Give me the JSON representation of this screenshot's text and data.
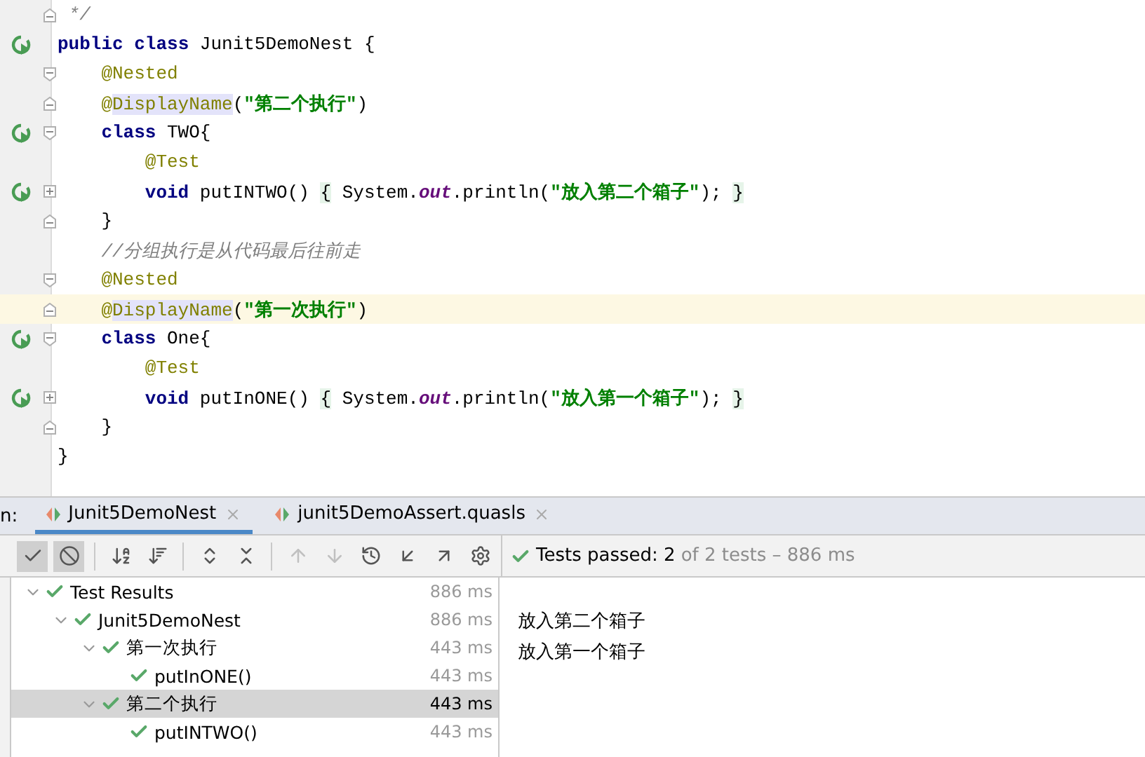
{
  "editor": {
    "lines": [
      {
        "run": false,
        "fold_open": false,
        "fold_close": true,
        "collapsed": false,
        "current": false,
        "tokens": [
          {
            "kind": "comment",
            "text": " */"
          }
        ]
      },
      {
        "run": true,
        "fold_open": false,
        "fold_close": false,
        "collapsed": false,
        "current": false,
        "tokens": [
          {
            "kind": "keyword",
            "text": "public class "
          },
          {
            "kind": "plain",
            "text": "Junit5DemoNest {"
          }
        ],
        "children": [
          {
            "run": false,
            "fold_open": true,
            "fold_close": false,
            "collapsed": false,
            "current": false,
            "tokens": [
              {
                "kind": "annotation",
                "text": "@Nested"
              }
            ]
          },
          {
            "run": false,
            "fold_open": false,
            "fold_close": true,
            "collapsed": false,
            "current": false,
            "tokens": [
              {
                "kind": "annotation",
                "text": "@"
              },
              {
                "kind": "annotation-ref",
                "text": "DisplayName"
              },
              {
                "kind": "plain",
                "text": "("
              },
              {
                "kind": "string",
                "text": "\"第二个执行\""
              },
              {
                "kind": "plain",
                "text": ")"
              }
            ]
          },
          {
            "run": true,
            "fold_open": true,
            "fold_close": false,
            "collapsed": false,
            "current": false,
            "tokens": [
              {
                "kind": "keyword",
                "text": "class "
              },
              {
                "kind": "plain",
                "text": "TWO{"
              }
            ],
            "children": [
              {
                "run": false,
                "fold_open": false,
                "fold_close": false,
                "collapsed": false,
                "current": false,
                "tokens": [
                  {
                    "kind": "annotation",
                    "text": "@Test"
                  }
                ]
              },
              {
                "run": true,
                "fold_open": false,
                "fold_close": false,
                "collapsed": true,
                "current": false,
                "tokens": [
                  {
                    "kind": "keyword",
                    "text": "void "
                  },
                  {
                    "kind": "plain",
                    "text": "putINTWO() "
                  },
                  {
                    "kind": "folded",
                    "text": "{"
                  },
                  {
                    "kind": "plain",
                    "text": " System."
                  },
                  {
                    "kind": "field",
                    "text": "out"
                  },
                  {
                    "kind": "plain",
                    "text": ".println("
                  },
                  {
                    "kind": "string",
                    "text": "\"放入第二个箱子\""
                  },
                  {
                    "kind": "plain",
                    "text": "); "
                  },
                  {
                    "kind": "folded",
                    "text": "}"
                  }
                ]
              }
            ]
          },
          {
            "run": false,
            "fold_open": false,
            "fold_close": true,
            "collapsed": false,
            "current": false,
            "tokens": [
              {
                "kind": "plain",
                "text": "}"
              }
            ]
          },
          {
            "run": false,
            "fold_open": false,
            "fold_close": false,
            "collapsed": false,
            "current": false,
            "tokens": [
              {
                "kind": "comment",
                "text": "//分组执行是从代码最后往前走"
              }
            ]
          },
          {
            "run": false,
            "fold_open": true,
            "fold_close": false,
            "collapsed": false,
            "current": false,
            "tokens": [
              {
                "kind": "annotation",
                "text": "@Nested"
              }
            ]
          },
          {
            "run": false,
            "fold_open": false,
            "fold_close": true,
            "collapsed": false,
            "current": true,
            "tokens": [
              {
                "kind": "annotation",
                "text": "@"
              },
              {
                "kind": "annotation-ref",
                "text": "DisplayName"
              },
              {
                "kind": "plain",
                "text": "("
              },
              {
                "kind": "string",
                "text": "\"第一次执行\""
              },
              {
                "kind": "plain",
                "text": ")"
              }
            ]
          },
          {
            "run": true,
            "fold_open": true,
            "fold_close": false,
            "collapsed": false,
            "current": false,
            "tokens": [
              {
                "kind": "keyword",
                "text": "class "
              },
              {
                "kind": "plain",
                "text": "One{"
              }
            ],
            "children": [
              {
                "run": false,
                "fold_open": false,
                "fold_close": false,
                "collapsed": false,
                "current": false,
                "tokens": [
                  {
                    "kind": "annotation",
                    "text": "@Test"
                  }
                ]
              },
              {
                "run": true,
                "fold_open": false,
                "fold_close": false,
                "collapsed": true,
                "current": false,
                "tokens": [
                  {
                    "kind": "keyword",
                    "text": "void "
                  },
                  {
                    "kind": "plain",
                    "text": "putInONE() "
                  },
                  {
                    "kind": "folded",
                    "text": "{"
                  },
                  {
                    "kind": "plain",
                    "text": " System."
                  },
                  {
                    "kind": "field",
                    "text": "out"
                  },
                  {
                    "kind": "plain",
                    "text": ".println("
                  },
                  {
                    "kind": "string",
                    "text": "\"放入第一个箱子\""
                  },
                  {
                    "kind": "plain",
                    "text": "); "
                  },
                  {
                    "kind": "folded",
                    "text": "}"
                  }
                ]
              }
            ]
          },
          {
            "run": false,
            "fold_open": false,
            "fold_close": true,
            "collapsed": false,
            "current": false,
            "tokens": [
              {
                "kind": "plain",
                "text": "}"
              }
            ]
          }
        ]
      },
      {
        "run": false,
        "fold_open": false,
        "fold_close": false,
        "collapsed": false,
        "current": false,
        "tokens": [
          {
            "kind": "plain",
            "text": "}"
          }
        ]
      }
    ]
  },
  "run_panel": {
    "label": "n:",
    "tabs": [
      {
        "label": "Junit5DemoNest",
        "selected": true
      },
      {
        "label": "junit5DemoAssert.quasls",
        "selected": false
      }
    ],
    "toolbar": [
      {
        "kind": "check",
        "on": true,
        "disabled": false
      },
      {
        "kind": "ban",
        "on": true,
        "disabled": false
      },
      {
        "kind": "separator"
      },
      {
        "kind": "sort-alpha",
        "on": false,
        "disabled": false
      },
      {
        "kind": "sort-duration",
        "on": false,
        "disabled": false
      },
      {
        "kind": "separator"
      },
      {
        "kind": "expand",
        "on": false,
        "disabled": false
      },
      {
        "kind": "collapse",
        "on": false,
        "disabled": false
      },
      {
        "kind": "separator"
      },
      {
        "kind": "up",
        "on": false,
        "disabled": true
      },
      {
        "kind": "down",
        "on": false,
        "disabled": true
      },
      {
        "kind": "history",
        "on": false,
        "disabled": false
      },
      {
        "kind": "import",
        "on": false,
        "disabled": false
      },
      {
        "kind": "export",
        "on": false,
        "disabled": false
      },
      {
        "kind": "gear",
        "on": false,
        "disabled": false
      }
    ],
    "status": {
      "passed": "Tests passed: 2",
      "detail": "of 2 tests – 886 ms"
    },
    "tree": [
      {
        "label": "Test Results",
        "time": "886 ms",
        "expanded": true,
        "selected": false,
        "children": [
          {
            "label": "Junit5DemoNest",
            "time": "886 ms",
            "expanded": true,
            "selected": false,
            "children": [
              {
                "label": "第一次执行",
                "time": "443 ms",
                "expanded": true,
                "selected": false,
                "children": [
                  {
                    "label": "putInONE()",
                    "time": "443 ms",
                    "selected": false
                  }
                ]
              },
              {
                "label": "第二个执行",
                "time": "443 ms",
                "expanded": true,
                "selected": true,
                "children": [
                  {
                    "label": "putINTWO()",
                    "time": "443 ms",
                    "selected": false
                  }
                ]
              }
            ]
          }
        ]
      }
    ],
    "output": [
      "放入第二个箱子",
      "放入第一个箱子"
    ]
  }
}
